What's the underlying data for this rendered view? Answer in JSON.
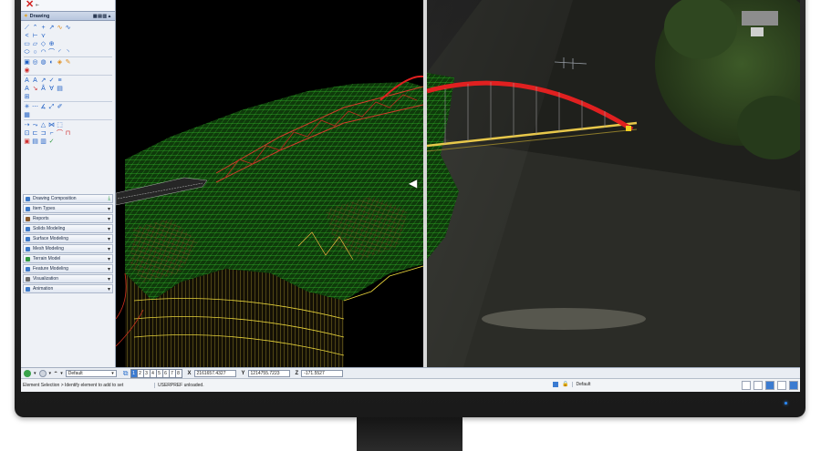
{
  "panel": {
    "drawing_header": "Drawing",
    "categories": [
      "Drawing Composition",
      "Item Types",
      "Reports",
      "Solids Modeling",
      "Surface Modeling",
      "Mesh Modeling",
      "Terrain Model",
      "Feature Modeling",
      "Visualization",
      "Animation"
    ]
  },
  "toolbar": {
    "active_style": "Default",
    "views": [
      "1",
      "2",
      "3",
      "4",
      "5",
      "6",
      "7",
      "8"
    ],
    "x_label": "X",
    "x_value": "2161657.4327",
    "y_label": "Y",
    "y_value": "1214755.7223",
    "z_label": "Z",
    "z_value": "-171.5527"
  },
  "status": {
    "message": "Element Selection > Identify element to add to set",
    "userpref": "USERPREF unloaded.",
    "level": "Default"
  },
  "colors": {
    "mesh_green": "#37d02e",
    "arch_red": "#e02020",
    "contour_yellow": "#e6d23a",
    "panel_blue": "#3b7bd1"
  },
  "icons": {
    "compare_left": "triangle-left-icon",
    "compare_right": "triangle-right-icon"
  }
}
